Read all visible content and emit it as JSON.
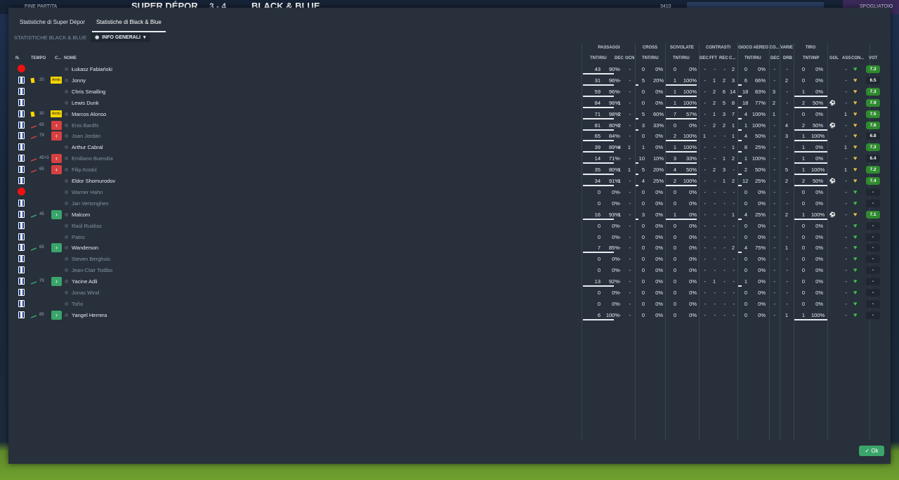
{
  "topbar": {
    "end_label": "FINE PARTITA",
    "team1": "SUPER DÉPOR",
    "score": "3 - 4",
    "team2": "BLACK & BLUE",
    "stat": "3410",
    "right": "SPOGLIATOIO"
  },
  "tabs": [
    {
      "label": "Statistiche di Super Dépor"
    },
    {
      "label": "Statistiche di Black & Blue"
    }
  ],
  "subtitle": "STATISTICHE BLACK & BLUE",
  "view_select": "INFO GENERALI",
  "groups": {
    "passaggi": "PASSAGGI",
    "cross": "CROSS",
    "scivolate": "SCIVOLATE",
    "contrasti": "CONTRASTI",
    "gioco_aereo": "GIOCO AEREO",
    "co": "CO...",
    "varie": "VARIE",
    "tiro": "TIRO"
  },
  "headers": {
    "n": "N.",
    "tempo": "TEMPO",
    "c": "C...",
    "nome": "NOME",
    "pass_tnt": "TNT/RIU",
    "dec": "DEC",
    "ocn": "OCN",
    "cross_tnt": "TNT/RIU",
    "sciv_tnt": "TNT/RIU",
    "con_dec": "DEC",
    "fft": "FFT",
    "rec": "REC",
    "aereo_tnt": "TNT/RIU",
    "co_dec": "DEC",
    "drb": "DRB",
    "tiro": "TNT/INP",
    "gol": "GOL",
    "ass": "ASS",
    "con": "CON...",
    "vot": "VOT"
  },
  "players": [
    {
      "name": "Łukasz Fabiański",
      "dim": false,
      "icon": "red",
      "min": "",
      "cap": false,
      "arrow": "",
      "p1": "43",
      "p2": "90%",
      "pd": "-",
      "po": "-",
      "c1": "0",
      "c2": "0%",
      "s1": "0",
      "s2": "0%",
      "cd": "-",
      "cf": "-",
      "cr": "-",
      "cc": "2",
      "a1": "0",
      "a2": "0%",
      "ad": "-",
      "dr": "-",
      "t1": "0",
      "t2": "0%",
      "gol": "",
      "ass": "-",
      "vote": "7.3",
      "vcol": "#2f8a2f",
      "heart": "#3ec04a"
    },
    {
      "name": "Jonny",
      "dim": false,
      "icon": "yellow",
      "min": "20",
      "cap": true,
      "arrow": "",
      "p1": "31",
      "p2": "96%",
      "pd": "-",
      "po": "-",
      "c1": "5",
      "c2": "20%",
      "s1": "1",
      "s2": "100%",
      "cd": "-",
      "cf": "1",
      "cr": "2",
      "cc": "3",
      "a1": "6",
      "a2": "66%",
      "ad": "-",
      "dr": "2",
      "t1": "0",
      "t2": "0%",
      "gol": "",
      "ass": "-",
      "vote": "6.5",
      "vcol": "#1f2731",
      "heart": "#e6b84a"
    },
    {
      "name": "Chris Smalling",
      "dim": false,
      "icon": "",
      "min": "",
      "cap": false,
      "arrow": "",
      "p1": "59",
      "p2": "96%",
      "pd": "-",
      "po": "-",
      "c1": "0",
      "c2": "0%",
      "s1": "1",
      "s2": "100%",
      "cd": "-",
      "cf": "2",
      "cr": "6",
      "cc": "14",
      "a1": "18",
      "a2": "83%",
      "ad": "3",
      "dr": "-",
      "t1": "1",
      "t2": "0%",
      "gol": "",
      "ass": "-",
      "vote": "7.3",
      "vcol": "#2f8a2f",
      "heart": "#e6b84a"
    },
    {
      "name": "Lewis Dunk",
      "dim": false,
      "icon": "",
      "min": "",
      "cap": false,
      "arrow": "",
      "p1": "84",
      "p2": "96%",
      "pd": "1",
      "po": "-",
      "c1": "0",
      "c2": "0%",
      "s1": "1",
      "s2": "100%",
      "cd": "-",
      "cf": "2",
      "cr": "5",
      "cc": "8",
      "a1": "18",
      "a2": "77%",
      "ad": "2",
      "dr": "-",
      "t1": "2",
      "t2": "50%",
      "gol": "⚽",
      "ass": "-",
      "vote": "7.9",
      "vcol": "#2f8a2f",
      "heart": "#e6b84a"
    },
    {
      "name": "Marcos Alonso",
      "dim": false,
      "icon": "yellow",
      "min": "30",
      "cap": true,
      "arrow": "",
      "p1": "71",
      "p2": "98%",
      "pd": "2",
      "po": "-",
      "c1": "5",
      "c2": "60%",
      "s1": "7",
      "s2": "57%",
      "cd": "-",
      "cf": "1",
      "cr": "3",
      "cc": "7",
      "a1": "4",
      "a2": "100%",
      "ad": "1",
      "dr": "-",
      "t1": "0",
      "t2": "0%",
      "gol": "",
      "ass": "1",
      "vote": "7.5",
      "vcol": "#2f8a2f",
      "heart": "#e6b84a"
    },
    {
      "name": "Enis Bardhi",
      "dim": true,
      "icon": "subout",
      "min": "65",
      "cap": false,
      "arrow": "out",
      "p1": "81",
      "p2": "80%",
      "pd": "2",
      "po": "-",
      "c1": "3",
      "c2": "33%",
      "s1": "0",
      "s2": "0%",
      "cd": "-",
      "cf": "2",
      "cr": "2",
      "cc": "1",
      "a1": "1",
      "a2": "100%",
      "ad": "-",
      "dr": "4",
      "t1": "2",
      "t2": "50%",
      "gol": "⚽",
      "ass": "-",
      "vote": "7.6",
      "vcol": "#2f8a2f",
      "heart": "#e6b84a"
    },
    {
      "name": "Joan Jordán",
      "dim": true,
      "icon": "subout",
      "min": "79",
      "cap": false,
      "arrow": "out",
      "p1": "65",
      "p2": "84%",
      "pd": "-",
      "po": "-",
      "c1": "0",
      "c2": "0%",
      "s1": "2",
      "s2": "100%",
      "cd": "1",
      "cf": "-",
      "cr": "-",
      "cc": "1",
      "a1": "4",
      "a2": "50%",
      "ad": "-",
      "dr": "3",
      "t1": "1",
      "t2": "100%",
      "gol": "",
      "ass": "-",
      "vote": "6.8",
      "vcol": "#1f2731",
      "heart": "#e6b84a"
    },
    {
      "name": "Arthur Cabral",
      "dim": false,
      "icon": "",
      "min": "",
      "cap": false,
      "arrow": "",
      "p1": "39",
      "p2": "89%",
      "pd": "4",
      "po": "1",
      "c1": "1",
      "c2": "0%",
      "s1": "1",
      "s2": "100%",
      "cd": "-",
      "cf": "-",
      "cr": "-",
      "cc": "1",
      "a1": "8",
      "a2": "25%",
      "ad": "-",
      "dr": "-",
      "t1": "1",
      "t2": "0%",
      "gol": "",
      "ass": "1",
      "vote": "7.3",
      "vcol": "#2f8a2f",
      "heart": "#e6b84a"
    },
    {
      "name": "Emiliano Buendía",
      "dim": true,
      "icon": "subout",
      "min": "45+3",
      "cap": false,
      "arrow": "out",
      "p1": "14",
      "p2": "71%",
      "pd": "-",
      "po": "-",
      "c1": "10",
      "c2": "10%",
      "s1": "3",
      "s2": "33%",
      "cd": "-",
      "cf": "-",
      "cr": "1",
      "cc": "2",
      "a1": "1",
      "a2": "100%",
      "ad": "-",
      "dr": "-",
      "t1": "1",
      "t2": "0%",
      "gol": "",
      "ass": "-",
      "vote": "6.4",
      "vcol": "#1f2731",
      "heart": "#e6b84a"
    },
    {
      "name": "Filip Kostić",
      "dim": true,
      "icon": "subout",
      "min": "65",
      "cap": false,
      "arrow": "out",
      "p1": "35",
      "p2": "80%",
      "pd": "1",
      "po": "1",
      "c1": "5",
      "c2": "20%",
      "s1": "4",
      "s2": "50%",
      "cd": "-",
      "cf": "2",
      "cr": "3",
      "cc": "-",
      "a1": "2",
      "a2": "50%",
      "ad": "-",
      "dr": "5",
      "t1": "1",
      "t2": "100%",
      "gol": "",
      "ass": "1",
      "vote": "7.2",
      "vcol": "#2f8a2f",
      "heart": "#e6b84a"
    },
    {
      "name": "Eldor Shomurodov",
      "dim": false,
      "icon": "",
      "min": "",
      "cap": false,
      "arrow": "",
      "p1": "34",
      "p2": "91%",
      "pd": "1",
      "po": "-",
      "c1": "4",
      "c2": "25%",
      "s1": "2",
      "s2": "100%",
      "cd": "-",
      "cf": "-",
      "cr": "1",
      "cc": "2",
      "a1": "12",
      "a2": "25%",
      "ad": "-",
      "dr": "2",
      "t1": "2",
      "t2": "50%",
      "gol": "⚽",
      "ass": "-",
      "vote": "7.4",
      "vcol": "#2f8a2f",
      "heart": "#e6b84a"
    },
    {
      "name": "Warner Hahn",
      "dim": true,
      "icon": "red",
      "min": "",
      "cap": false,
      "arrow": "",
      "p1": "0",
      "p2": "0%",
      "pd": "-",
      "po": "-",
      "c1": "0",
      "c2": "0%",
      "s1": "0",
      "s2": "0%",
      "cd": "-",
      "cf": "-",
      "cr": "-",
      "cc": "-",
      "a1": "0",
      "a2": "0%",
      "ad": "-",
      "dr": "-",
      "t1": "0",
      "t2": "0%",
      "gol": "",
      "ass": "-",
      "vote": "-",
      "vcol": "#1f2731",
      "heart": "#3ec04a"
    },
    {
      "name": "Jan Vertonghen",
      "dim": true,
      "icon": "",
      "min": "",
      "cap": false,
      "arrow": "",
      "p1": "0",
      "p2": "0%",
      "pd": "-",
      "po": "-",
      "c1": "0",
      "c2": "0%",
      "s1": "0",
      "s2": "0%",
      "cd": "-",
      "cf": "-",
      "cr": "-",
      "cc": "-",
      "a1": "0",
      "a2": "0%",
      "ad": "-",
      "dr": "-",
      "t1": "0",
      "t2": "0%",
      "gol": "",
      "ass": "-",
      "vote": "-",
      "vcol": "#1f2731",
      "heart": "#3ec04a"
    },
    {
      "name": "Malcom",
      "dim": false,
      "icon": "subin",
      "min": "45",
      "cap": false,
      "arrow": "in",
      "p1": "16",
      "p2": "93%",
      "pd": "1",
      "po": "-",
      "c1": "3",
      "c2": "0%",
      "s1": "1",
      "s2": "0%",
      "cd": "-",
      "cf": "-",
      "cr": "-",
      "cc": "1",
      "a1": "4",
      "a2": "25%",
      "ad": "-",
      "dr": "2",
      "t1": "1",
      "t2": "100%",
      "gol": "⚽",
      "ass": "-",
      "vote": "7.1",
      "vcol": "#2f8a2f",
      "heart": "#e6b84a"
    },
    {
      "name": "Raúl Ruidíaz",
      "dim": true,
      "icon": "",
      "min": "",
      "cap": false,
      "arrow": "",
      "p1": "0",
      "p2": "0%",
      "pd": "-",
      "po": "-",
      "c1": "0",
      "c2": "0%",
      "s1": "0",
      "s2": "0%",
      "cd": "-",
      "cf": "-",
      "cr": "-",
      "cc": "-",
      "a1": "0",
      "a2": "0%",
      "ad": "-",
      "dr": "-",
      "t1": "0",
      "t2": "0%",
      "gol": "",
      "ass": "-",
      "vote": "-",
      "vcol": "#1f2731",
      "heart": "#3ec04a"
    },
    {
      "name": "Patric",
      "dim": true,
      "icon": "",
      "min": "",
      "cap": false,
      "arrow": "",
      "p1": "0",
      "p2": "0%",
      "pd": "-",
      "po": "-",
      "c1": "0",
      "c2": "0%",
      "s1": "0",
      "s2": "0%",
      "cd": "-",
      "cf": "-",
      "cr": "-",
      "cc": "-",
      "a1": "0",
      "a2": "0%",
      "ad": "-",
      "dr": "-",
      "t1": "0",
      "t2": "0%",
      "gol": "",
      "ass": "-",
      "vote": "-",
      "vcol": "#1f2731",
      "heart": "#3ec04a"
    },
    {
      "name": "Wanderson",
      "dim": false,
      "icon": "subin",
      "min": "65",
      "cap": false,
      "arrow": "in",
      "p1": "7",
      "p2": "85%",
      "pd": "-",
      "po": "-",
      "c1": "0",
      "c2": "0%",
      "s1": "0",
      "s2": "0%",
      "cd": "-",
      "cf": "-",
      "cr": "-",
      "cc": "2",
      "a1": "4",
      "a2": "75%",
      "ad": "-",
      "dr": "1",
      "t1": "0",
      "t2": "0%",
      "gol": "",
      "ass": "-",
      "vote": "-",
      "vcol": "#1f2731",
      "heart": "#3ec04a"
    },
    {
      "name": "Steven Berghuis",
      "dim": true,
      "icon": "",
      "min": "",
      "cap": false,
      "arrow": "",
      "p1": "0",
      "p2": "0%",
      "pd": "-",
      "po": "-",
      "c1": "0",
      "c2": "0%",
      "s1": "0",
      "s2": "0%",
      "cd": "-",
      "cf": "-",
      "cr": "-",
      "cc": "-",
      "a1": "0",
      "a2": "0%",
      "ad": "-",
      "dr": "-",
      "t1": "0",
      "t2": "0%",
      "gol": "",
      "ass": "-",
      "vote": "-",
      "vcol": "#1f2731",
      "heart": "#3ec04a"
    },
    {
      "name": "Jean-Clair Todibo",
      "dim": true,
      "icon": "",
      "min": "",
      "cap": false,
      "arrow": "",
      "p1": "0",
      "p2": "0%",
      "pd": "-",
      "po": "-",
      "c1": "0",
      "c2": "0%",
      "s1": "0",
      "s2": "0%",
      "cd": "-",
      "cf": "-",
      "cr": "-",
      "cc": "-",
      "a1": "0",
      "a2": "0%",
      "ad": "-",
      "dr": "-",
      "t1": "0",
      "t2": "0%",
      "gol": "",
      "ass": "-",
      "vote": "-",
      "vcol": "#1f2731",
      "heart": "#3ec04a"
    },
    {
      "name": "Yacine Adli",
      "dim": false,
      "icon": "subin",
      "min": "79",
      "cap": false,
      "arrow": "in",
      "p1": "13",
      "p2": "92%",
      "pd": "-",
      "po": "-",
      "c1": "0",
      "c2": "0%",
      "s1": "0",
      "s2": "0%",
      "cd": "-",
      "cf": "1",
      "cr": "-",
      "cc": "-",
      "a1": "1",
      "a2": "0%",
      "ad": "-",
      "dr": "-",
      "t1": "0",
      "t2": "0%",
      "gol": "",
      "ass": "-",
      "vote": "-",
      "vcol": "#1f2731",
      "heart": "#3ec04a"
    },
    {
      "name": "Jonas Wind",
      "dim": true,
      "icon": "",
      "min": "",
      "cap": false,
      "arrow": "",
      "p1": "0",
      "p2": "0%",
      "pd": "-",
      "po": "-",
      "c1": "0",
      "c2": "0%",
      "s1": "0",
      "s2": "0%",
      "cd": "-",
      "cf": "-",
      "cr": "-",
      "cc": "-",
      "a1": "0",
      "a2": "0%",
      "ad": "-",
      "dr": "-",
      "t1": "0",
      "t2": "0%",
      "gol": "",
      "ass": "-",
      "vote": "-",
      "vcol": "#1f2731",
      "heart": "#3ec04a"
    },
    {
      "name": "Toño",
      "dim": true,
      "icon": "",
      "min": "",
      "cap": false,
      "arrow": "",
      "p1": "0",
      "p2": "0%",
      "pd": "-",
      "po": "-",
      "c1": "0",
      "c2": "0%",
      "s1": "0",
      "s2": "0%",
      "cd": "-",
      "cf": "-",
      "cr": "-",
      "cc": "-",
      "a1": "0",
      "a2": "0%",
      "ad": "-",
      "dr": "-",
      "t1": "0",
      "t2": "0%",
      "gol": "",
      "ass": "-",
      "vote": "-",
      "vcol": "#1f2731",
      "heart": "#3ec04a"
    },
    {
      "name": "Yangel Herrera",
      "dim": false,
      "icon": "subin",
      "min": "85",
      "cap": false,
      "arrow": "in",
      "p1": "6",
      "p2": "100%",
      "pd": "-",
      "po": "-",
      "c1": "0",
      "c2": "0%",
      "s1": "0",
      "s2": "0%",
      "cd": "-",
      "cf": "-",
      "cr": "-",
      "cc": "-",
      "a1": "0",
      "a2": "0%",
      "ad": "-",
      "dr": "1",
      "t1": "1",
      "t2": "100%",
      "gol": "",
      "ass": "-",
      "vote": "-",
      "vcol": "#1f2731",
      "heart": "#3ec04a"
    }
  ],
  "ok_label": "Ok",
  "colors": {
    "green": "#3aa56a",
    "red": "#d84040",
    "yellow": "#f5d400"
  }
}
